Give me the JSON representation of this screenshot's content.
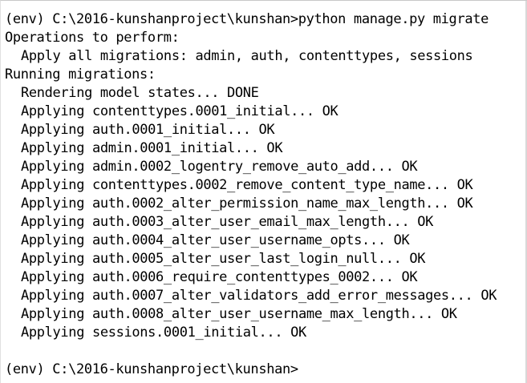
{
  "terminal": {
    "command_prompt": "(env) C:\\2016-kunshanproject\\kunshan>python manage.py migrate",
    "operations_header": "Operations to perform:",
    "apply_all": "Apply all migrations: admin, auth, contenttypes, sessions",
    "running_header": "Running migrations:",
    "rendering": "Rendering model states... DONE",
    "migrations": [
      "Applying contenttypes.0001_initial... OK",
      "Applying auth.0001_initial... OK",
      "Applying admin.0001_initial... OK",
      "Applying admin.0002_logentry_remove_auto_add... OK",
      "Applying contenttypes.0002_remove_content_type_name... OK",
      "Applying auth.0002_alter_permission_name_max_length... OK",
      "Applying auth.0003_alter_user_email_max_length... OK",
      "Applying auth.0004_alter_user_username_opts... OK",
      "Applying auth.0005_alter_user_last_login_null... OK",
      "Applying auth.0006_require_contenttypes_0002... OK",
      "Applying auth.0007_alter_validators_add_error_messages... OK",
      "Applying auth.0008_alter_user_username_max_length... OK",
      "Applying sessions.0001_initial... OK"
    ],
    "final_prompt": "(env) C:\\2016-kunshanproject\\kunshan>"
  }
}
